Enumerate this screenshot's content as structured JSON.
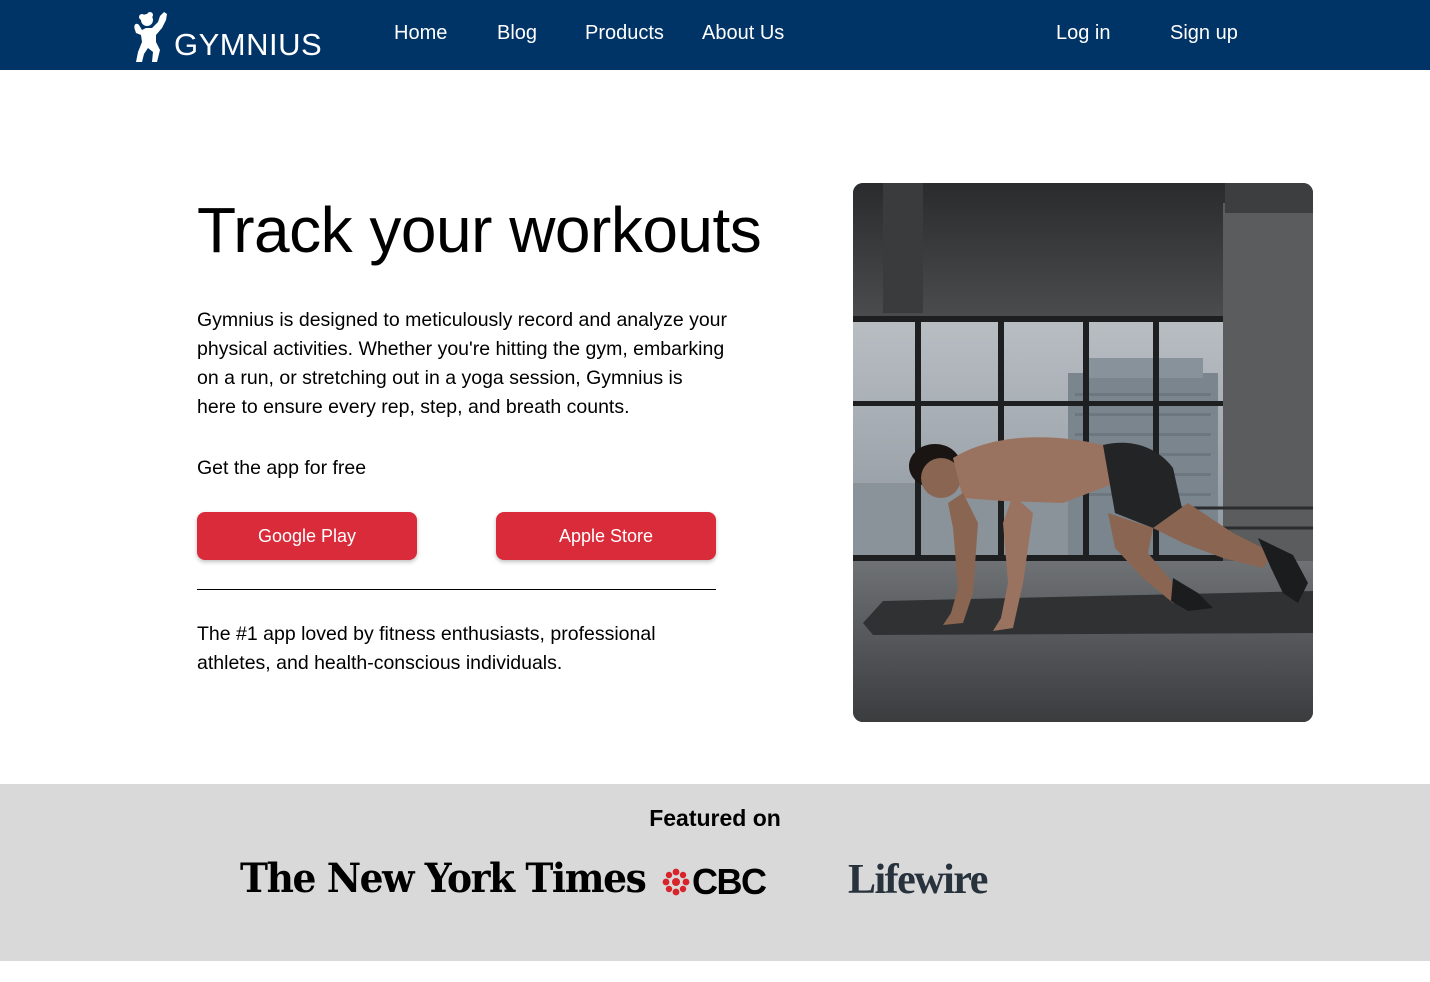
{
  "nav": {
    "brand": "GYMNIUS",
    "links": [
      "Home",
      "Blog",
      "Products",
      "About Us"
    ],
    "login_label": "Log in",
    "signup_label": "Sign up",
    "background_color": "#003366"
  },
  "hero": {
    "title": "Track your workouts",
    "description": "Gymnius is designed to meticulously record and analyze your physical activities. Whether you're hitting the gym, embarking on a run, or stretching out in a yoga session, Gymnius is here to ensure every rep, step, and breath counts.",
    "get_app_text": "Get the app for free",
    "google_play_label": "Google Play",
    "apple_store_label": "Apple Store",
    "tagline": "The #1 app loved by fitness enthusiasts, professional athletes, and health-conscious individuals.",
    "button_color": "#d92b3a",
    "image_icon": "man-doing-mountain-climber-photo"
  },
  "featured": {
    "title": "Featured on",
    "brands": [
      "The New York Times",
      "CBC",
      "Lifewire"
    ],
    "background_color": "#d9d9d9"
  }
}
